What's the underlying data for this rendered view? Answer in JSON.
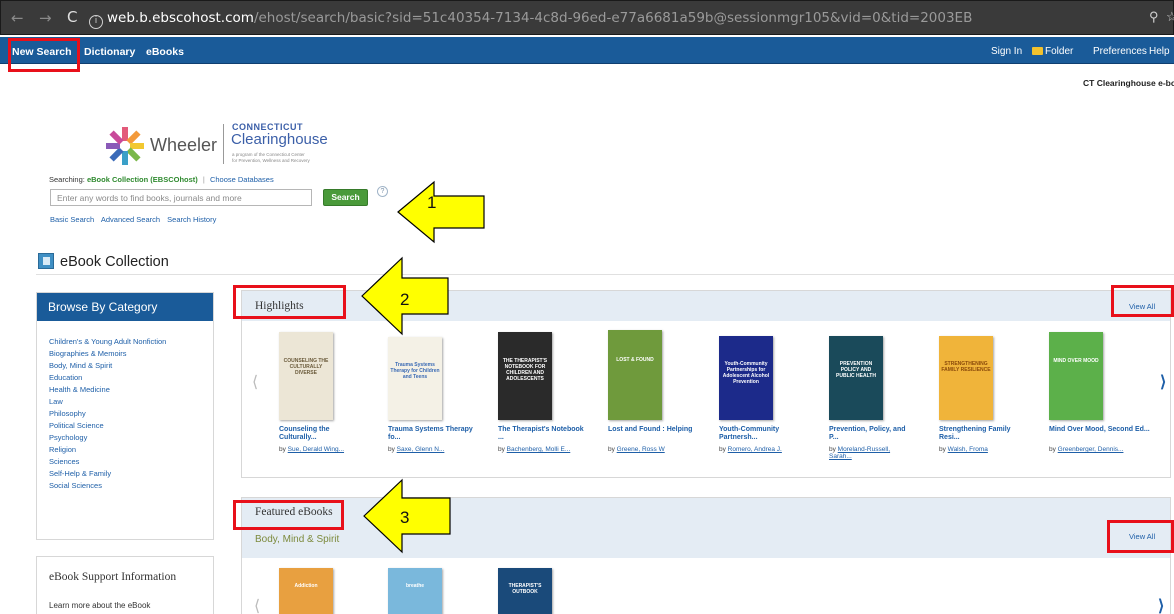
{
  "browser": {
    "url_host": "web.b.ebscohost.com",
    "url_path": "/ehost/search/basic?sid=51c40354-7134-4c8d-96ed-e77a6681a59b@sessionmgr105&vid=0&tid=2003EB"
  },
  "toolbar": {
    "new_search": "New Search",
    "dictionary": "Dictionary",
    "ebooks": "eBooks",
    "sign_in": "Sign In",
    "folder": "Folder",
    "preferences": "Preferences",
    "help": "Help"
  },
  "library_label": "CT Clearinghouse e-bo",
  "logo": {
    "wheeler": "Wheeler",
    "connecticut": "CONNECTICUT",
    "clearinghouse": "Clearinghouse",
    "sub_line1": "a program of the Connecticut Center",
    "sub_line2": "for Prevention, Wellness and Recovery"
  },
  "search": {
    "searching_label": "Searching:",
    "collection": "eBook Collection (EBSCOhost)",
    "choose_databases": "Choose Databases",
    "placeholder": "Enter any words to find books, journals and more",
    "button": "Search",
    "help_glyph": "?",
    "links": [
      "Basic Search",
      "Advanced Search",
      "Search History"
    ]
  },
  "page_title": "eBook Collection",
  "browse": {
    "heading": "Browse By Category",
    "categories": [
      "Children's & Young Adult Nonfiction",
      "Biographies & Memoirs",
      "Body, Mind & Spirit",
      "Education",
      "Health & Medicine",
      "Law",
      "Philosophy",
      "Political Science",
      "Psychology",
      "Religion",
      "Sciences",
      "Self-Help & Family",
      "Social Sciences"
    ]
  },
  "support": {
    "heading": "eBook Support Information",
    "text": "Learn more about the eBook"
  },
  "highlights": {
    "title": "Highlights",
    "view_all": "View All",
    "books": [
      {
        "title": "Counseling the Culturally...",
        "author_prefix": "by ",
        "author": "Sue, Derald Wing...",
        "cover_text": "COUNSELING THE CULTURALLY DIVERSE",
        "cover_bg": "#ece6d6",
        "cover_fg": "#6a5a3a"
      },
      {
        "title": "Trauma Systems Therapy fo...",
        "author_prefix": "by ",
        "author": "Saxe, Glenn N...",
        "cover_text": "Trauma Systems Therapy for Children and Teens",
        "cover_bg": "#f4f1e6",
        "cover_fg": "#3a6ab4"
      },
      {
        "title": "The Therapist's Notebook ...",
        "author_prefix": "by ",
        "author": "Bachenberg, Molli E...",
        "cover_text": "THE THERAPIST'S NOTEBOOK FOR CHILDREN AND ADOLESCENTS",
        "cover_bg": "#2a2a2a",
        "cover_fg": "#ffffff"
      },
      {
        "title": "Lost and Found : Helping",
        "author_prefix": "by ",
        "author": "Greene, Ross W",
        "cover_text": "LOST & FOUND",
        "cover_bg": "#6f9a3c",
        "cover_fg": "#ffffff"
      },
      {
        "title": "Youth-Community Partnersh...",
        "author_prefix": "by ",
        "author": "Romero, Andrea J.",
        "cover_text": "Youth-Community Partnerships for Adolescent Alcohol Prevention",
        "cover_bg": "#1c2a8a",
        "cover_fg": "#ffffff"
      },
      {
        "title": "Prevention, Policy, and P...",
        "author_prefix": "by ",
        "author": "Moreland-Russell, Sarah...",
        "cover_text": "PREVENTION POLICY AND PUBLIC HEALTH",
        "cover_bg": "#1a4a5a",
        "cover_fg": "#ffffff"
      },
      {
        "title": "Strengthening Family Resi...",
        "author_prefix": "by ",
        "author": "Walsh, Froma",
        "cover_text": "STRENGTHENING FAMILY RESILIENCE",
        "cover_bg": "#f0b43a",
        "cover_fg": "#8a4a0a"
      },
      {
        "title": "Mind Over Mood, Second Ed...",
        "author_prefix": "by ",
        "author": "Greenberger, Dennis...",
        "cover_text": "MIND OVER MOOD",
        "cover_bg": "#5cb04a",
        "cover_fg": "#ffffff"
      }
    ]
  },
  "featured": {
    "title": "Featured eBooks",
    "subtitle": "Body, Mind & Spirit",
    "view_all": "View All",
    "books": [
      {
        "cover_text": "Addiction",
        "cover_bg": "#e8a040",
        "cover_fg": "#ffffff"
      },
      {
        "cover_text": "breathe",
        "cover_bg": "#7ab8dc",
        "cover_fg": "#ffffff"
      },
      {
        "cover_text": "THERAPIST'S OUTBOOK",
        "cover_bg": "#1a4a7a",
        "cover_fg": "#ffffff"
      }
    ]
  },
  "annotations": {
    "arrow1": "1",
    "arrow2": "2",
    "arrow3": "3"
  },
  "colors": {
    "toolbar_blue": "#1a5b99",
    "link_blue": "#1e5fa8",
    "search_green": "#4a9a3a",
    "highlight_red": "#e8101a",
    "arrow_yellow": "#ffff00"
  }
}
